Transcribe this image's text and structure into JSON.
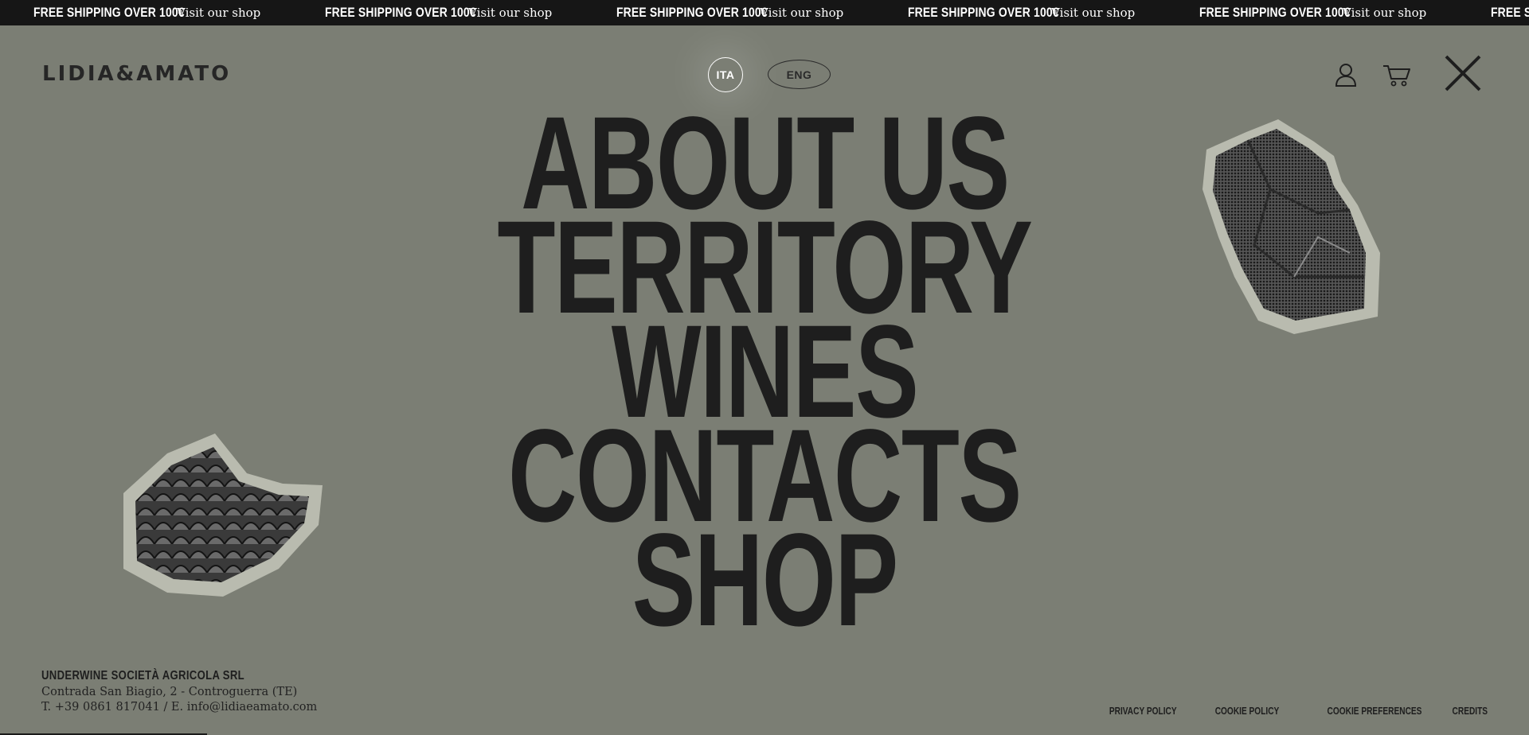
{
  "ticker": {
    "items": [
      {
        "bold": "FREE SHIPPING OVER 100€",
        "link": "Visit our shop"
      },
      {
        "bold": "FREE SHIPPING OVER 100€",
        "link": "Visit our shop"
      },
      {
        "bold": "FREE SHIPPING OVER 100€",
        "link": "Visit our shop"
      },
      {
        "bold": "FREE SHIPPING OVER 100€",
        "link": "Visit our shop"
      },
      {
        "bold": "FREE SHIPPING OVER 100€",
        "link": "Visit our shop"
      },
      {
        "bold": "FREE SH"
      }
    ]
  },
  "header": {
    "logo": "LIDIA&AMATO",
    "lang_ita": "ITA",
    "lang_eng": "ENG",
    "icons": [
      "user-icon",
      "cart-icon",
      "close-icon"
    ]
  },
  "menu": {
    "items": [
      "ABOUT US",
      "TERRITORY",
      "WINES",
      "CONTACTS",
      "SHOP"
    ]
  },
  "footer": {
    "company": "UNDERWINE SOCIETÀ AGRICOLA SRL",
    "address": "Contrada San Biagio, 2 - Controguerra (TE)",
    "contact": "T. +39 0861 817041 / E. info@lidiaeamato.com",
    "links": [
      "PRIVACY POLICY",
      "COOKIE POLICY",
      "COOKIE PREFERENCES",
      "CREDITS"
    ]
  },
  "colors": {
    "background": "#7b7e74",
    "ticker_bg": "#161616",
    "text": "#1e1e1e"
  }
}
